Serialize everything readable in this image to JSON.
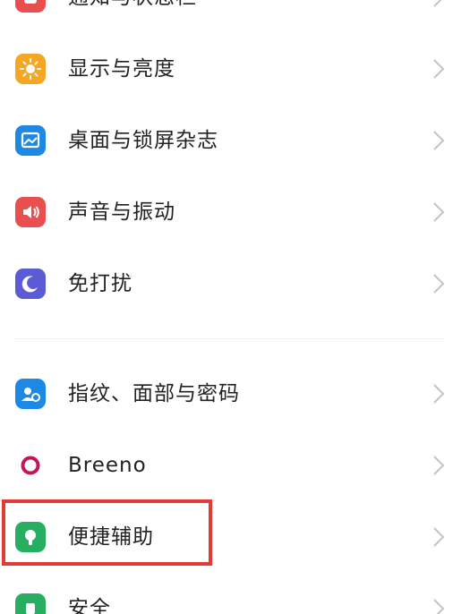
{
  "settings": {
    "items": [
      {
        "label": "通知与状态栏",
        "icon": "notification-icon",
        "color": "#e94f4f"
      },
      {
        "label": "显示与亮度",
        "icon": "sun-icon",
        "color": "#f5a623"
      },
      {
        "label": "桌面与锁屏杂志",
        "icon": "wallpaper-icon",
        "color": "#1e88e5"
      },
      {
        "label": "声音与振动",
        "icon": "speaker-icon",
        "color": "#e94f4f"
      },
      {
        "label": "免打扰",
        "icon": "moon-icon",
        "color": "#5b5bd6"
      },
      {
        "label": "指纹、面部与密码",
        "icon": "fingerprint-face-icon",
        "color": "#1e88e5"
      },
      {
        "label": "Breeno",
        "icon": "breeno-icon",
        "color": "#c2185b"
      },
      {
        "label": "便捷辅助",
        "icon": "convenience-icon",
        "color": "#27ae60"
      },
      {
        "label": "安全",
        "icon": "security-icon",
        "color": "#27ae60"
      }
    ]
  },
  "highlight": {
    "color": "#e53935"
  }
}
